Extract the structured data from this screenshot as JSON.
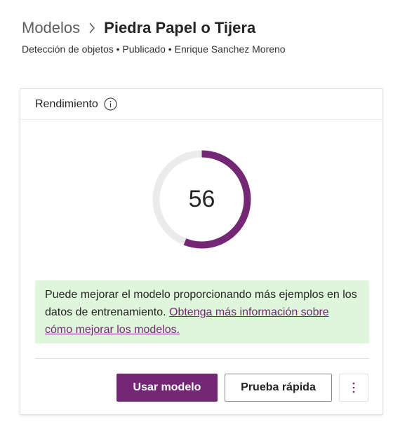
{
  "breadcrumb": {
    "parent": "Modelos",
    "separator_icon": "chevron-right-icon",
    "current": "Piedra Papel o Tijera"
  },
  "meta": {
    "text": "Detección de objetos • Publicado • Enrique Sanchez Moreno"
  },
  "performance_card": {
    "title": "Rendimiento",
    "info_icon": "info-icon",
    "score": "56",
    "score_fraction": 0.56,
    "notice_text": "Puede mejorar el modelo proporcionando más ejemplos en los datos de entrenamiento.",
    "notice_link": "Obtenga más información sobre cómo mejorar los modelos.",
    "use_model_button": "Usar modelo",
    "quick_test_button": "Prueba rápida",
    "more_icon": "more-vertical-icon"
  },
  "colors": {
    "accent": "#742774",
    "track": "#ebebeb",
    "notice_bg": "#dff6dd"
  }
}
